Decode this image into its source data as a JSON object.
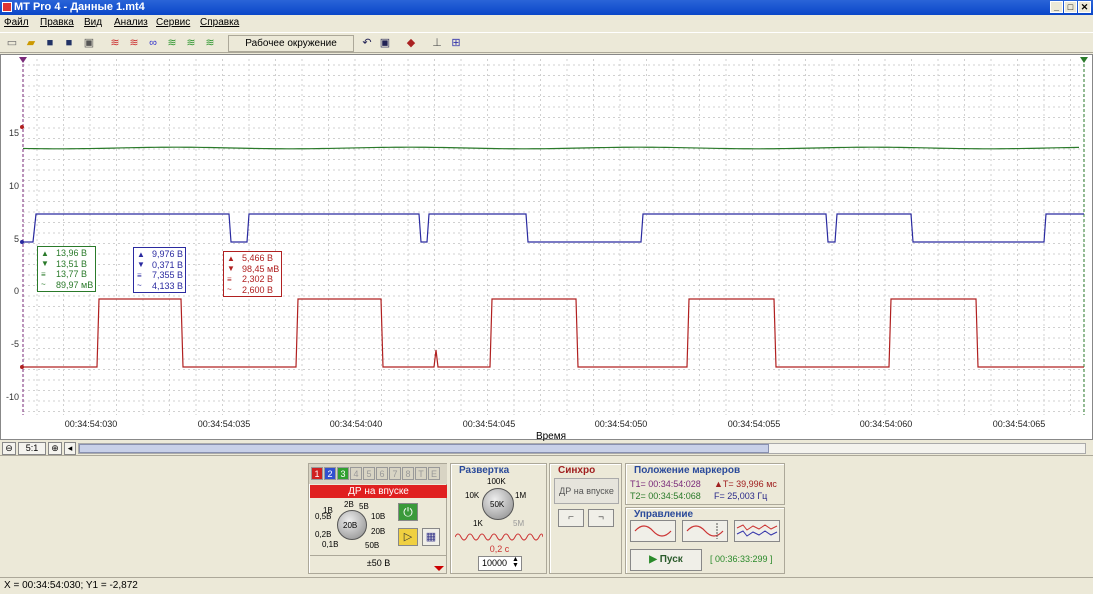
{
  "window": {
    "title": "MT Pro 4 - Данные 1.mt4",
    "min": "_",
    "max": "□",
    "close": "✕"
  },
  "menu": [
    "Файл",
    "Правка",
    "Вид",
    "Анализ",
    "Сервис",
    "Справка"
  ],
  "toolbar": {
    "workspace": "Рабочее окружение",
    "icons": [
      "new-icon",
      "open-icon",
      "save-icon",
      "save-as-icon",
      "export-icon",
      "wave1-icon",
      "wave2-icon",
      "wave3-icon",
      "wave4-icon",
      "wave5-icon",
      "wave6-icon",
      "undo-icon",
      "redo-icon",
      "probe-icon",
      "measure-icon",
      "grid-icon"
    ]
  },
  "plot": {
    "y_ticks": [
      "15",
      "10",
      "5",
      "0",
      "-5",
      "-10"
    ],
    "x_ticks": [
      "00:34:54:030",
      "00:34:54:035",
      "00:34:54:040",
      "00:34:54:045",
      "00:34:54:050",
      "00:34:54:055",
      "00:34:54:060",
      "00:34:54:065"
    ],
    "x_label": "Время",
    "colors": {
      "green": "#2a7a2a",
      "blue": "#2a2aa0",
      "red": "#b02020",
      "grid": "#d0d0d0"
    }
  },
  "measurements": {
    "green": {
      "max": "13,96 В",
      "min": "13,51 В",
      "avg": "13,77 В",
      "ripple": "89,97 мВ"
    },
    "blue": {
      "max": "9,976 В",
      "min": "0,371 В",
      "avg": "7,355 В",
      "ripple": "4,133 В"
    },
    "red": {
      "max": "5,466 В",
      "min": "98,45 мВ",
      "avg": "2,302 В",
      "ripple": "2,600 В"
    }
  },
  "zoom": {
    "ratio": "5:1"
  },
  "channel_panel": {
    "tabs": [
      "1",
      "2",
      "3",
      "4",
      "5",
      "6",
      "7",
      "8",
      "Т",
      "Е"
    ],
    "name": "ДР на впуске",
    "range_labels": [
      "2В",
      "5В",
      "1В",
      "10В",
      "0,5В",
      "20В",
      "0,2В",
      "50В",
      "0,1В"
    ],
    "knob_value": "20В",
    "range": "±50 В"
  },
  "sweep_panel": {
    "title": "Развертка",
    "labels": [
      "100K",
      "10K",
      "1M",
      "1K",
      "5M"
    ],
    "knob_value": "50K",
    "time": "0,2 с",
    "points": "10000"
  },
  "sync_panel": {
    "title": "Синхро",
    "source": "ДР на впуске"
  },
  "markers_panel": {
    "title": "Положение маркеров",
    "t1": "T1= 00:34:54:028",
    "t2": "T2= 00:34:54:068",
    "dt": "▲T= 39,996 мс",
    "freq": "F= 25,003 Гц"
  },
  "control_panel": {
    "title": "Управление",
    "start": "Пуск",
    "elapsed": "[ 00:36:33:299 ]"
  },
  "status": {
    "coords": "X = 00:34:54:030; Y1 = -2,872"
  }
}
